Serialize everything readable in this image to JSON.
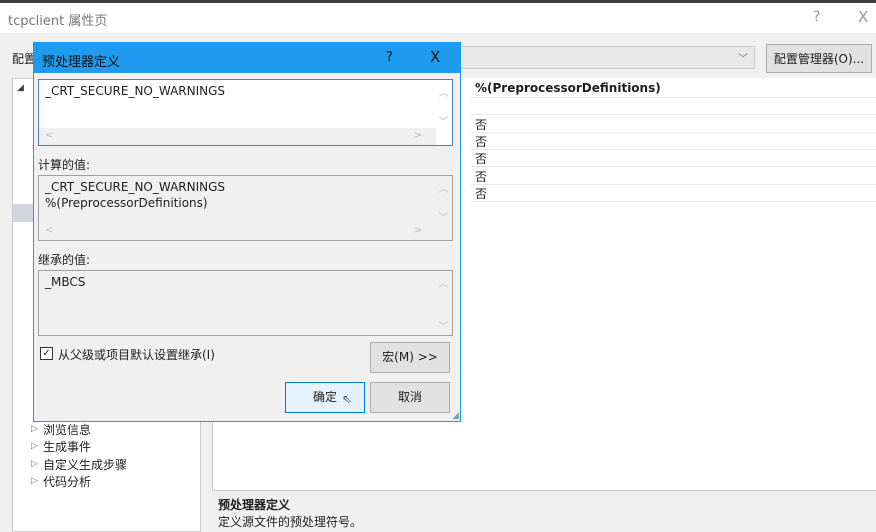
{
  "window": {
    "title": "tcpclient 属性页",
    "help": "?",
    "close": "X"
  },
  "config": {
    "label": "配置",
    "manager_button": "配置管理器(O)..."
  },
  "tree": {
    "items": [
      "浏览信息",
      "生成事件",
      "自定义生成步骤",
      "代码分析"
    ]
  },
  "grid": {
    "rows": [
      "%(PreprocessorDefinitions)",
      "",
      "否",
      "否",
      "否",
      "否",
      "否"
    ]
  },
  "description": {
    "title": "预处理器定义",
    "text": "定义源文件的预处理符号。"
  },
  "dialog": {
    "title": "预处理器定义",
    "help": "?",
    "close": "X",
    "value": "_CRT_SECURE_NO_WARNINGS",
    "computed_label": "计算的值:",
    "computed_value": "_CRT_SECURE_NO_WARNINGS\n%(PreprocessorDefinitions)",
    "inherited_label": "继承的值:",
    "inherited_value": "_MBCS",
    "inherit_checkbox": "从父级或项目默认设置继承(I)",
    "inherit_checked": true,
    "macro_button": "宏(M) >>",
    "ok_button": "确定",
    "cancel_button": "取消"
  }
}
